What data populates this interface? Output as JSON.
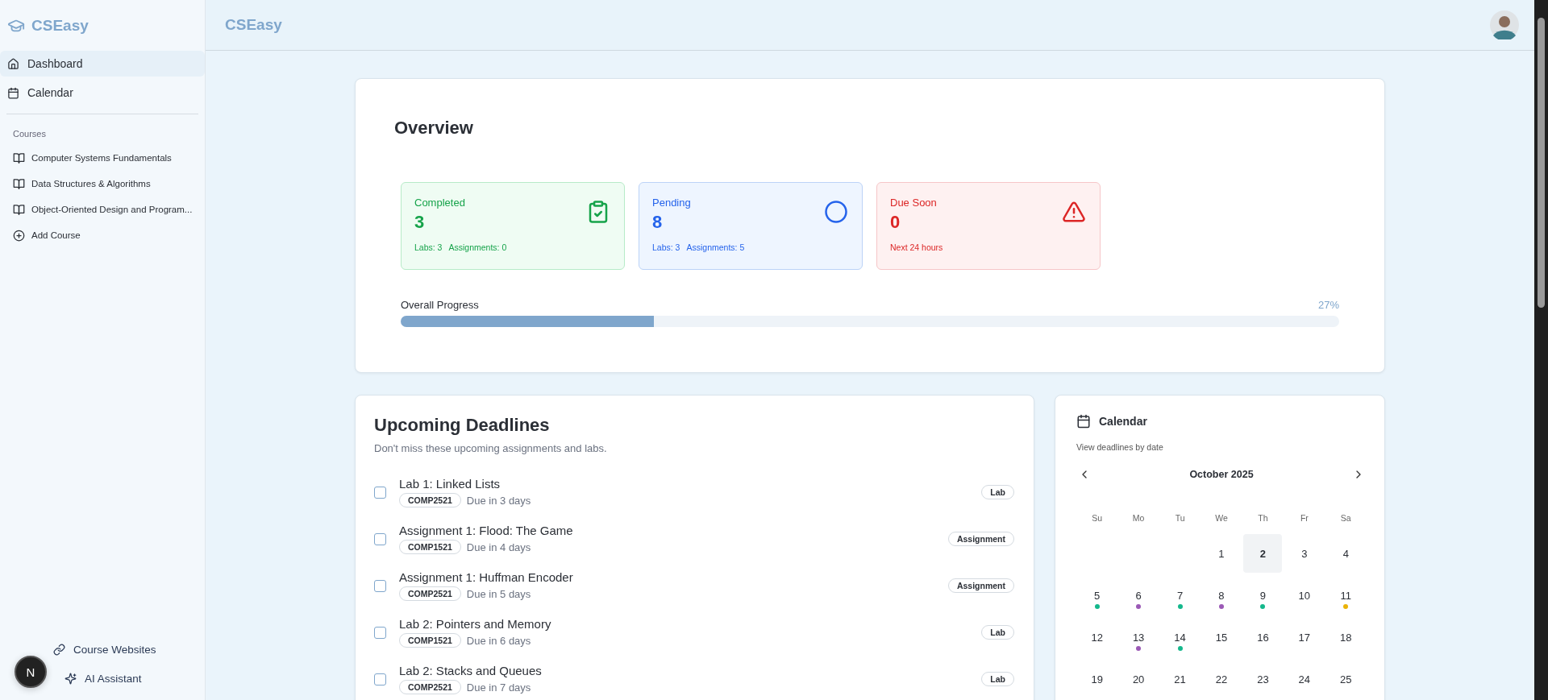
{
  "sidebar": {
    "brand": "CSEasy",
    "nav": [
      {
        "label": "Dashboard",
        "selected": true
      },
      {
        "label": "Calendar",
        "selected": false
      }
    ],
    "courses_heading": "Courses",
    "courses": [
      {
        "label": "Computer Systems Fundamentals",
        "kind": "course"
      },
      {
        "label": "Data Structures & Algorithms",
        "kind": "course"
      },
      {
        "label": "Object-Oriented Design and Program...",
        "kind": "course"
      },
      {
        "label": "Add Course",
        "kind": "add"
      }
    ],
    "footer_links": [
      {
        "label": "Course Websites"
      },
      {
        "label": "AI Assistant"
      }
    ],
    "dev_badge": "N"
  },
  "header": {
    "title": "CSEasy"
  },
  "overview": {
    "title": "Overview",
    "stats": [
      {
        "kind": "completed",
        "label": "Completed",
        "value": "3",
        "details": [
          "Labs: 3",
          "Assignments: 0"
        ]
      },
      {
        "kind": "pending",
        "label": "Pending",
        "value": "8",
        "details": [
          "Labs: 3",
          "Assignments: 5"
        ]
      },
      {
        "kind": "due_soon",
        "label": "Due Soon",
        "value": "0",
        "details": [
          "Next 24 hours"
        ]
      }
    ],
    "progress": {
      "label": "Overall Progress",
      "reading": "27%",
      "level": 0.27
    }
  },
  "deadlines": {
    "title": "Upcoming Deadlines",
    "subtitle": "Don't miss these upcoming assignments and labs.",
    "items": [
      {
        "title": "Lab 1: Linked Lists",
        "course": "COMP2521",
        "due": "Due in 3 days",
        "type": "Lab",
        "checked": false
      },
      {
        "title": "Assignment 1: Flood: The Game",
        "course": "COMP1521",
        "due": "Due in 4 days",
        "type": "Assignment",
        "checked": false
      },
      {
        "title": "Assignment 1: Huffman Encoder",
        "course": "COMP2521",
        "due": "Due in 5 days",
        "type": "Assignment",
        "checked": false
      },
      {
        "title": "Lab 2: Pointers and Memory",
        "course": "COMP1521",
        "due": "Due in 6 days",
        "type": "Lab",
        "checked": false
      },
      {
        "title": "Lab 2: Stacks and Queues",
        "course": "COMP2521",
        "due": "Due in 7 days",
        "type": "Lab",
        "checked": false
      }
    ]
  },
  "calendar": {
    "title": "Calendar",
    "subtitle": "View deadlines by date",
    "month": "October 2025",
    "weekdays": [
      "Su",
      "Mo",
      "Tu",
      "We",
      "Th",
      "Fr",
      "Sa"
    ],
    "weeks": [
      [
        {
          "label": "1",
          "selected": false
        },
        {
          "label": "2",
          "selected": true
        },
        {
          "label": "3",
          "selected": false
        },
        {
          "label": "4",
          "selected": false
        }
      ],
      [
        {
          "label": "5",
          "selected": false,
          "color": "#14b88c"
        },
        {
          "label": "6",
          "selected": false,
          "color": "#9b59b6"
        },
        {
          "label": "7",
          "selected": false,
          "color": "#14b88c"
        },
        {
          "label": "8",
          "selected": false,
          "color": "#9b59b6"
        },
        {
          "label": "9",
          "selected": false,
          "color": "#14b88c"
        },
        {
          "label": "10",
          "selected": false
        },
        {
          "label": "11",
          "selected": false,
          "color": "#eab308"
        }
      ],
      [
        {
          "label": "12",
          "selected": false
        },
        {
          "label": "13",
          "selected": false,
          "color": "#9b59b6"
        },
        {
          "label": "14",
          "selected": false,
          "color": "#14b88c"
        },
        {
          "label": "15",
          "selected": false
        },
        {
          "label": "16",
          "selected": false
        },
        {
          "label": "17",
          "selected": false
        },
        {
          "label": "18",
          "selected": false
        }
      ],
      [
        {
          "label": "19",
          "selected": false
        },
        {
          "label": "20",
          "selected": false
        },
        {
          "label": "21",
          "selected": false
        },
        {
          "label": "22",
          "selected": false
        },
        {
          "label": "23",
          "selected": false
        },
        {
          "label": "24",
          "selected": false
        },
        {
          "label": "25",
          "selected": false
        }
      ]
    ]
  }
}
